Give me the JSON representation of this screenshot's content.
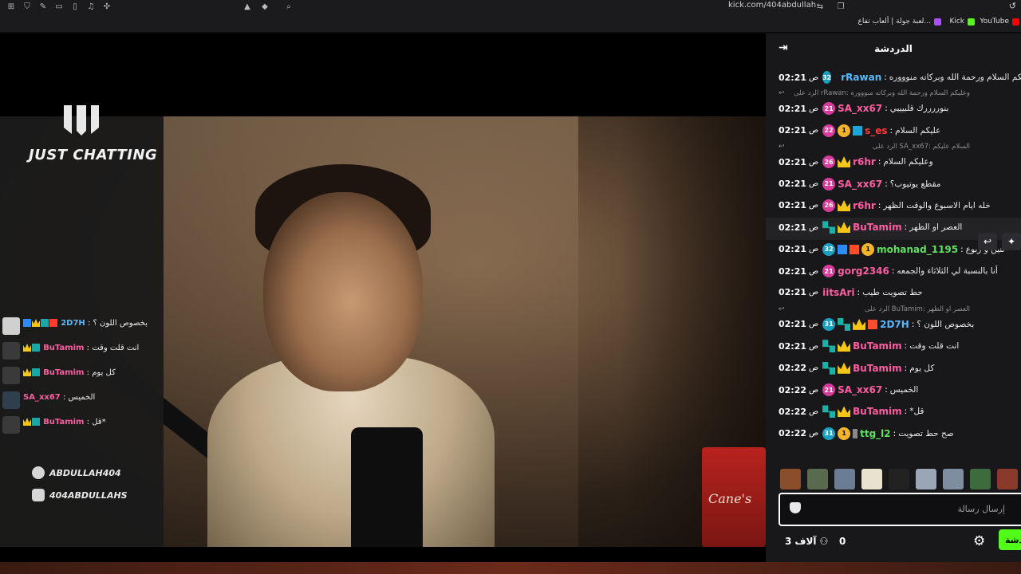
{
  "browser": {
    "url": "kick.com/404abdullah",
    "bookmarks": [
      {
        "label": "YouTube",
        "color": "#ff0000"
      },
      {
        "label": "Kick",
        "color": "#53fc18"
      },
      {
        "label": "لعبة جولة | ألعاب تفاع...",
        "color": "#b14bff"
      }
    ]
  },
  "stream": {
    "category_label": "JUST CHATTING",
    "cup_text": "Cane's",
    "socials": [
      {
        "icon": "snapchat-icon",
        "handle": "ABDULLAH404"
      },
      {
        "icon": "instagram-icon",
        "handle": "404ABDULLAHS"
      }
    ],
    "overlay_chat": [
      {
        "user": "2D7H",
        "text": "بخصوص اللون ؟",
        "color": "blue"
      },
      {
        "user": "BuTamim",
        "text": "انت قلت وقت",
        "color": "pink"
      },
      {
        "user": "BuTamim",
        "text": "كل يوم",
        "color": "pink"
      },
      {
        "user": "SA_xx67",
        "text": "الخميس",
        "color": "blue"
      },
      {
        "user": "BuTamim",
        "text": "قل*",
        "color": "pink"
      }
    ]
  },
  "chat": {
    "title": "الدردشة",
    "input_placeholder": "إرسال رسالة",
    "viewers": "3 آلاف",
    "count_zero": "0",
    "chat_button": "دردشة",
    "messages": [
      {
        "time": "02:21",
        "son": "ص",
        "sub": "32",
        "sub_class": "s-teal",
        "badges": [
          "og",
          "vip",
          "crown"
        ],
        "user": "rRawan",
        "color": "#56b9ff",
        "text": "عليكم السلام ورحمة الله وبركاته منوووره"
      },
      {
        "reply": "الرد على rRawan: وعليكم السلام ورحمة الله وبركاته منوووره"
      },
      {
        "time": "02:21",
        "son": "ص",
        "sub": "21",
        "sub_class": "s-pink",
        "badges": [],
        "user": "SA_xx67",
        "color": "#ff5da2",
        "text": "بنوررررك قلبيييي"
      },
      {
        "time": "02:21",
        "son": "ص",
        "sub": "22",
        "sub_class": "s-pink",
        "badges": [
          "gold",
          "vipblue"
        ],
        "user": "s_es",
        "color": "#ff3b3b",
        "text": "عليكم السلام"
      },
      {
        "reply": "الرد على SA_xx67: السلام عليكم"
      },
      {
        "time": "02:21",
        "son": "ص",
        "sub": "26",
        "sub_class": "s-pink",
        "badges": [
          "crown"
        ],
        "user": "r6hr",
        "color": "#ff5da2",
        "text": "وعليكم السلام"
      },
      {
        "time": "02:21",
        "son": "ص",
        "sub": "21",
        "sub_class": "s-pink",
        "badges": [],
        "user": "SA_xx67",
        "color": "#ff5da2",
        "text": "مقطع يوتيوب؟"
      },
      {
        "time": "02:21",
        "son": "ص",
        "sub": "26",
        "sub_class": "s-pink",
        "badges": [
          "crown"
        ],
        "user": "r6hr",
        "color": "#ff5da2",
        "text": "خله ايام الاسبوع والوقت الظهر"
      },
      {
        "time": "02:21",
        "son": "ص",
        "sub": "",
        "sub_class": "",
        "badges": [
          "vip",
          "crown"
        ],
        "user": "BuTamim",
        "color": "#ff5da2",
        "text": "العصر او الظهر",
        "highlight": true
      },
      {
        "time": "02:21",
        "son": "ص",
        "sub": "32",
        "sub_class": "s-teal",
        "badges": [
          "blue",
          "og",
          "gold"
        ],
        "user": "mohanad_1195",
        "color": "#5fe05f",
        "text": "ثنين و ربوع"
      },
      {
        "time": "02:21",
        "son": "ص",
        "sub": "21",
        "sub_class": "s-pink",
        "badges": [],
        "user": "gorg2346",
        "color": "#ff5da2",
        "text": "أنا بالنسبة لي الثلاثاء والجمعه"
      },
      {
        "time": "02:21",
        "son": "ص",
        "sub": "",
        "sub_class": "",
        "badges": [],
        "user": "iitsAri",
        "color": "#ff5da2",
        "text": "حط تصويت طيب"
      },
      {
        "reply": "الرد على BuTamim: العصر او الظهر"
      },
      {
        "time": "02:21",
        "son": "ص",
        "sub": "31",
        "sub_class": "s-teal",
        "badges": [
          "vip",
          "crown",
          "og"
        ],
        "user": "2D7H",
        "color": "#56b9ff",
        "text": "بخصوص اللون ؟"
      },
      {
        "time": "02:21",
        "son": "ص",
        "sub": "",
        "sub_class": "",
        "badges": [
          "vip",
          "crown"
        ],
        "user": "BuTamim",
        "color": "#ff5da2",
        "text": "انت قلت وقت"
      },
      {
        "time": "02:22",
        "son": "ص",
        "sub": "",
        "sub_class": "",
        "badges": [
          "vip",
          "crown"
        ],
        "user": "BuTamim",
        "color": "#ff5da2",
        "text": "كل يوم"
      },
      {
        "time": "02:22",
        "son": "ص",
        "sub": "21",
        "sub_class": "s-pink",
        "badges": [],
        "user": "SA_xx67",
        "color": "#ff5da2",
        "text": "الخميس"
      },
      {
        "time": "02:22",
        "son": "ص",
        "sub": "",
        "sub_class": "",
        "badges": [
          "vip",
          "crown"
        ],
        "user": "BuTamim",
        "color": "#ff5da2",
        "text": "قل*"
      },
      {
        "time": "02:22",
        "son": "ص",
        "sub": "31",
        "sub_class": "s-teal",
        "badges": [
          "gold",
          "gray"
        ],
        "user": "ttg_l2",
        "color": "#5fe05f",
        "text": "صح حط تصويت"
      }
    ]
  }
}
